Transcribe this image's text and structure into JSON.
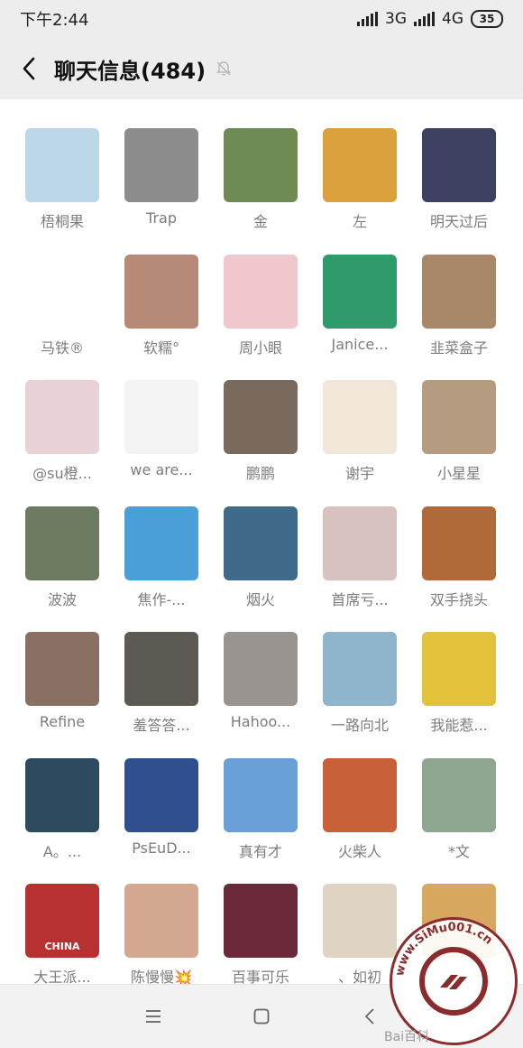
{
  "status": {
    "time": "下午2:44",
    "net1": "3G",
    "net2": "4G",
    "battery": "35"
  },
  "header": {
    "title": "聊天信息(484)"
  },
  "members": [
    {
      "name": "梧桐果",
      "color": "#bcd7e8"
    },
    {
      "name": "Trap",
      "color": "#8d8d8d"
    },
    {
      "name": "金",
      "color": "#6f8a52"
    },
    {
      "name": "左",
      "color": "#d9a03b"
    },
    {
      "name": "明天过后",
      "color": "#3d4260"
    },
    {
      "name": "马铁®",
      "color": "#ffffff"
    },
    {
      "name": "软糯°",
      "color": "#b78a78"
    },
    {
      "name": "周小眼",
      "color": "#f0c8cc"
    },
    {
      "name": "Janice...",
      "color": "#2f9a6a"
    },
    {
      "name": "韭菜盒子",
      "color": "#a88868"
    },
    {
      "name": "@su橙...",
      "color": "#e9d2d6"
    },
    {
      "name": "we are...",
      "color": "#f4f4f4"
    },
    {
      "name": "鹏鹏",
      "color": "#7a6a5e"
    },
    {
      "name": "谢宇",
      "color": "#f2e6d8"
    },
    {
      "name": "小星星",
      "color": "#b59c80"
    },
    {
      "name": "波波",
      "color": "#6c7a60"
    },
    {
      "name": "焦作-...",
      "color": "#4a9fd8"
    },
    {
      "name": "烟火",
      "color": "#3f6a8a"
    },
    {
      "name": "首席亏...",
      "color": "#d8c2c0"
    },
    {
      "name": "双手挠头",
      "color": "#b06a3a"
    },
    {
      "name": "Refine",
      "color": "#8a6f64"
    },
    {
      "name": "羞答答...",
      "color": "#5c5a52"
    },
    {
      "name": "Hahoo...",
      "color": "#9a9490"
    },
    {
      "name": "一路向北",
      "color": "#8fb5cc"
    },
    {
      "name": "我能惹...",
      "color": "#e2c23a"
    },
    {
      "name": "A。...",
      "color": "#2e4a5e"
    },
    {
      "name": "PsEuD...",
      "color": "#2f4f8f"
    },
    {
      "name": "真有才",
      "color": "#6aa0d8"
    },
    {
      "name": "火柴人",
      "color": "#c8603a"
    },
    {
      "name": "*文",
      "color": "#8fa690"
    },
    {
      "name": "大王派...",
      "color": "#b83030",
      "badge": "CHINA"
    },
    {
      "name": "陈慢慢💥",
      "color": "#d4a890"
    },
    {
      "name": "百事可乐",
      "color": "#6a2a3a"
    },
    {
      "name": "、如初",
      "color": "#e0d4c4"
    },
    {
      "name": "",
      "color": "#d8a860"
    }
  ],
  "watermark": {
    "text": "www.SiMu001.cn",
    "baidu": "Bai百科"
  }
}
